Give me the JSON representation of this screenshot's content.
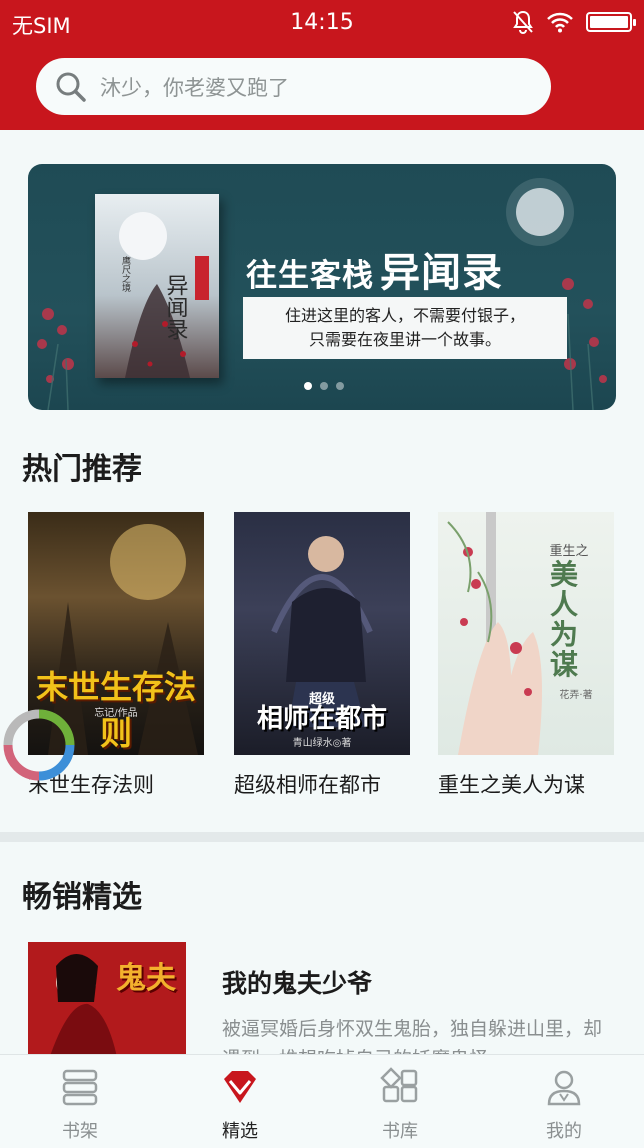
{
  "status_bar": {
    "carrier": "无SIM",
    "time": "14:15",
    "icons": [
      "mute-icon",
      "wifi-icon",
      "battery-icon"
    ]
  },
  "search": {
    "placeholder": "沐少，你老婆又跑了"
  },
  "banner": {
    "title_small": "往生客栈",
    "title_big": "异闻录",
    "tagline_line1": "住进这里的客人，不需要付银子，",
    "tagline_line2": "只需要在夜里讲一个故事。",
    "cover_text": "往生客栈 异闻录",
    "cover_author": "鹰尺之境",
    "page_count": 3,
    "active_page": 1
  },
  "hot": {
    "title": "热门推荐",
    "books": [
      {
        "name": "末世生存法则",
        "cover_text": "末世生存法则",
        "cover_author": "忘记/作品"
      },
      {
        "name": "超级相师在都市",
        "cover_text": "相师在都市",
        "cover_sub": "超级",
        "cover_author": "青山绿水◎著"
      },
      {
        "name": "重生之美人为谋",
        "cover_text": "美人为谋",
        "cover_sub": "重生之",
        "cover_author": "花弄·著"
      }
    ]
  },
  "bestseller": {
    "title": "畅销精选",
    "book": {
      "name": "我的鬼夫少爷",
      "description": "被逼冥婚后身怀双生鬼胎，独自躲进山里，却遇到一堆想吃掉自己的妖魔鬼怪",
      "cover_text": "鬼夫"
    }
  },
  "tabs": [
    {
      "label": "书架",
      "icon": "bookshelf-icon",
      "active": false
    },
    {
      "label": "精选",
      "icon": "gem-icon",
      "active": true
    },
    {
      "label": "书库",
      "icon": "grid-icon",
      "active": false
    },
    {
      "label": "我的",
      "icon": "profile-icon",
      "active": false
    }
  ],
  "colors": {
    "brand_red": "#c8161d",
    "background": "#f3f9f9",
    "muted_text": "#8a8f90"
  }
}
